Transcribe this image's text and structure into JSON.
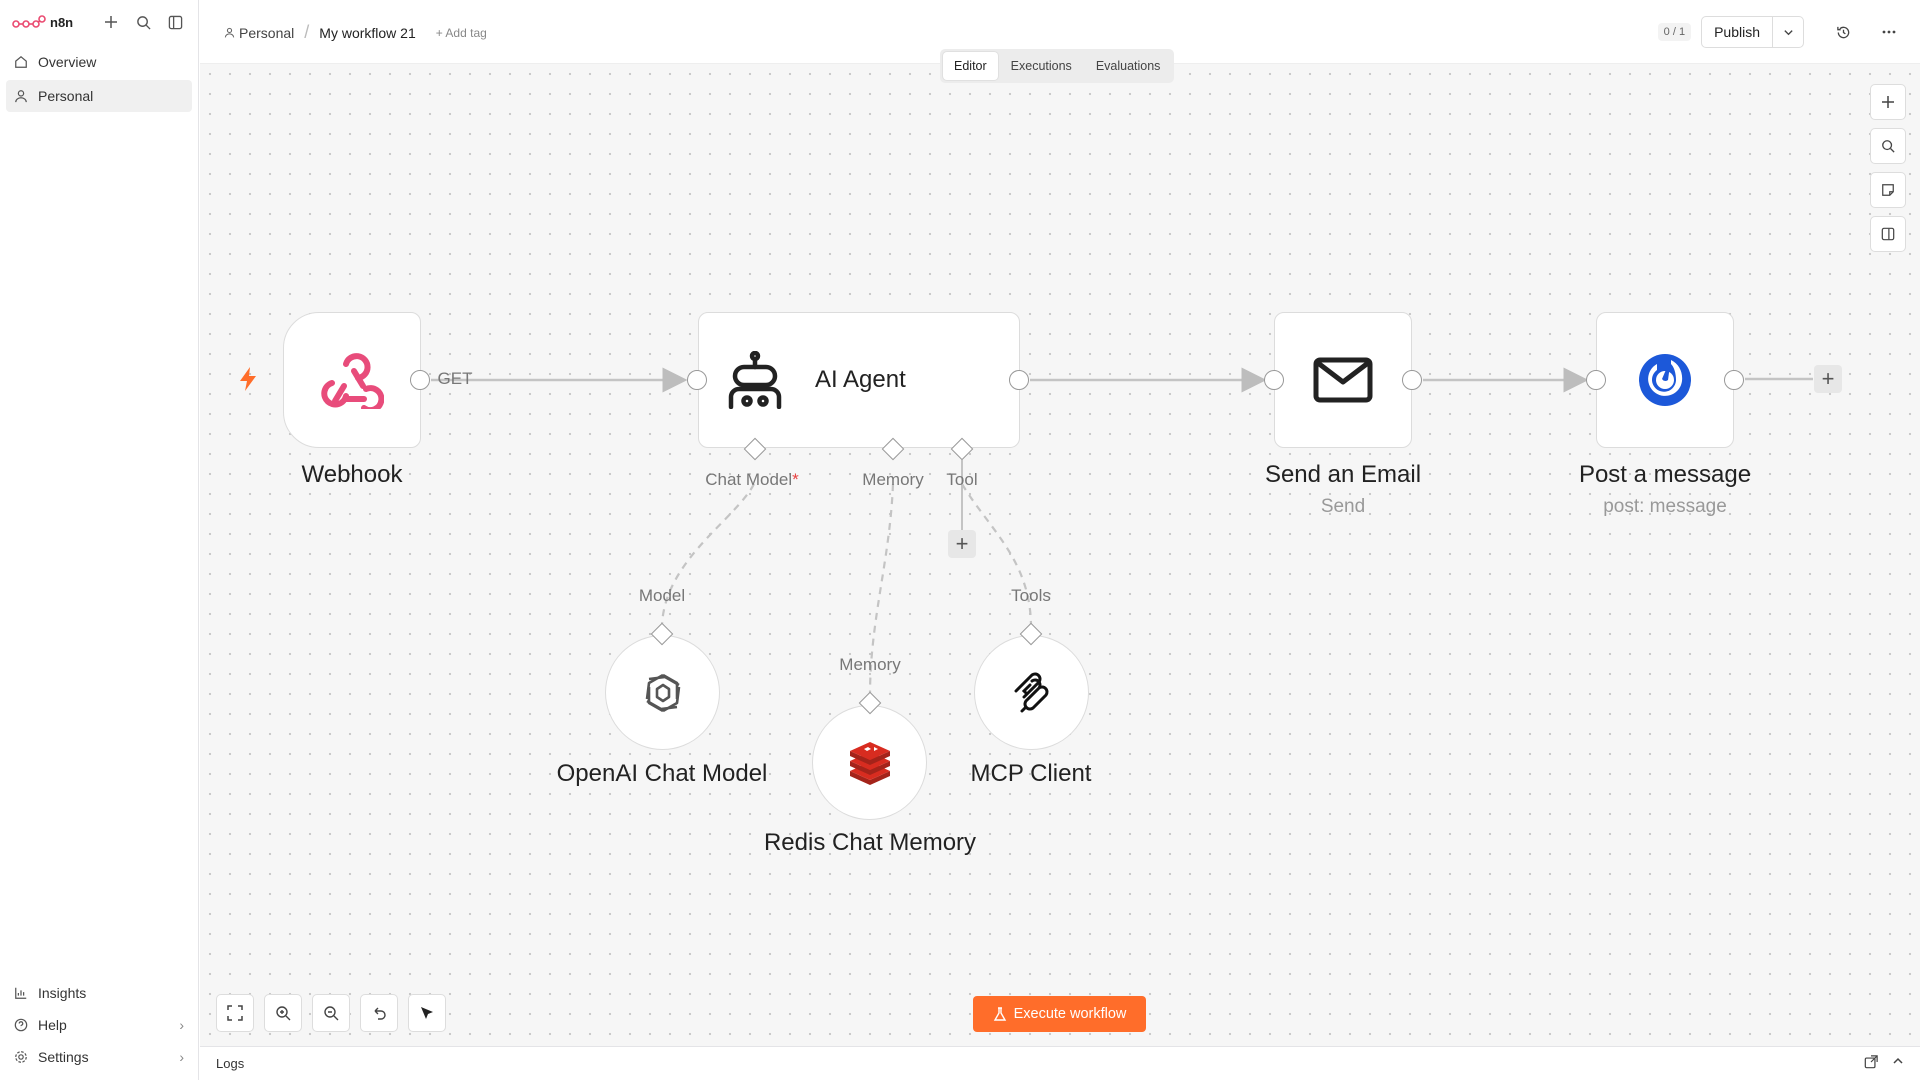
{
  "sidebar": {
    "logo_text": "n8n",
    "items": [
      {
        "label": "Overview",
        "icon": "home-icon"
      },
      {
        "label": "Personal",
        "icon": "user-icon"
      }
    ],
    "bottom": [
      {
        "label": "Insights",
        "icon": "chart-icon"
      },
      {
        "label": "Help",
        "icon": "help-icon"
      },
      {
        "label": "Settings",
        "icon": "gear-icon"
      }
    ]
  },
  "header": {
    "project": "Personal",
    "workflow_name": "My workflow 21",
    "add_tag": "+ Add tag",
    "counter": "0 / 1",
    "publish": "Publish"
  },
  "tabs": [
    "Editor",
    "Executions",
    "Evaluations"
  ],
  "nodes": {
    "webhook": {
      "name": "Webhook",
      "out_label": "GET"
    },
    "agent": {
      "name": "AI Agent",
      "ports": [
        "Chat Model",
        "Memory",
        "Tool"
      ],
      "required_mark": "*"
    },
    "email": {
      "name": "Send an Email",
      "subtitle": "Send"
    },
    "mattermost": {
      "name": "Post a message",
      "subtitle": "post: message"
    },
    "openai": {
      "name": "OpenAI Chat Model",
      "port_label": "Model"
    },
    "redis": {
      "name": "Redis Chat Memory",
      "port_label": "Memory"
    },
    "mcp": {
      "name": "MCP Client",
      "port_label": "Tools"
    }
  },
  "execute_button": "Execute workflow",
  "logs_label": "Logs",
  "colors": {
    "accent": "#ff6d2a",
    "webhook": "#e84c7b",
    "redis": "#d82c20",
    "mattermost": "#1c58d9"
  }
}
